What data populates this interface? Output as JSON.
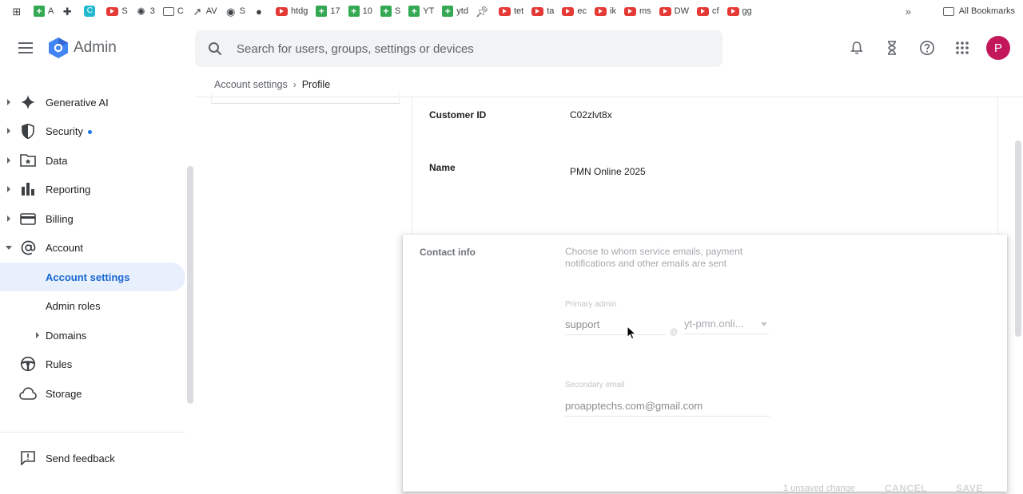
{
  "bookmarks": {
    "items": [
      {
        "label": "",
        "icon": "apps-grid-icon",
        "type": "plain"
      },
      {
        "label": "A",
        "icon": "sheets-icon",
        "type": "sheet"
      },
      {
        "label": "",
        "icon": "puzzle-icon",
        "type": "plain"
      },
      {
        "label": "",
        "icon": "canva-icon",
        "type": "canva"
      },
      {
        "label": "S",
        "icon": "youtube-icon",
        "type": "yt"
      },
      {
        "label": "3",
        "icon": "openai-icon",
        "type": "plain"
      },
      {
        "label": "C",
        "icon": "folder-icon",
        "type": "folder"
      },
      {
        "label": "AV",
        "icon": "trend-icon",
        "type": "plain"
      },
      {
        "label": "S",
        "icon": "globe-icon",
        "type": "plain"
      },
      {
        "label": "",
        "icon": "github-icon",
        "type": "plain"
      },
      {
        "label": "htdg",
        "icon": "youtube-icon",
        "type": "yt"
      },
      {
        "label": "17",
        "icon": "sheets-icon",
        "type": "sheet"
      },
      {
        "label": "10",
        "icon": "sheets-icon",
        "type": "sheet"
      },
      {
        "label": "S",
        "icon": "sheets-icon",
        "type": "sheet"
      },
      {
        "label": "YT",
        "icon": "sheets-icon",
        "type": "sheet"
      },
      {
        "label": "ytd",
        "icon": "sheets-icon",
        "type": "sheet"
      },
      {
        "label": "",
        "icon": "pin-icon",
        "type": "plain"
      },
      {
        "label": "tet",
        "icon": "youtube-icon",
        "type": "yt"
      },
      {
        "label": "ta",
        "icon": "youtube-icon",
        "type": "yt"
      },
      {
        "label": "ec",
        "icon": "youtube-icon",
        "type": "yt"
      },
      {
        "label": "ik",
        "icon": "youtube-icon",
        "type": "yt"
      },
      {
        "label": "ms",
        "icon": "youtube-icon",
        "type": "yt"
      },
      {
        "label": "DW",
        "icon": "youtube-icon",
        "type": "yt"
      },
      {
        "label": "cf",
        "icon": "youtube-icon",
        "type": "yt"
      },
      {
        "label": "gg",
        "icon": "youtube-icon",
        "type": "yt"
      }
    ],
    "more": "»",
    "all_bookmarks": "All Bookmarks"
  },
  "header": {
    "app_name": "Admin",
    "search_placeholder": "Search for users, groups, settings or devices",
    "avatar_letter": "P"
  },
  "breadcrumb": {
    "parent": "Account settings",
    "separator": "›",
    "current": "Profile"
  },
  "sidebar": {
    "items": [
      {
        "key": "generative-ai",
        "label": "Generative AI"
      },
      {
        "key": "security",
        "label": "Security"
      },
      {
        "key": "data",
        "label": "Data"
      },
      {
        "key": "reporting",
        "label": "Reporting"
      },
      {
        "key": "billing",
        "label": "Billing"
      },
      {
        "key": "account",
        "label": "Account"
      },
      {
        "key": "account-settings",
        "label": "Account settings"
      },
      {
        "key": "admin-roles",
        "label": "Admin roles"
      },
      {
        "key": "domains",
        "label": "Domains"
      },
      {
        "key": "rules",
        "label": "Rules"
      },
      {
        "key": "storage",
        "label": "Storage"
      }
    ],
    "feedback": "Send feedback"
  },
  "profile": {
    "customer_id_label": "Customer ID",
    "customer_id_value": "C02zlvt8x",
    "name_label": "Name",
    "name_value": "PMN Online 2025"
  },
  "contact": {
    "label": "Contact info",
    "description": "Choose to whom service emails, payment notifications and other emails are sent",
    "primary_admin_label": "Primary admin",
    "primary_admin_value": "support",
    "at_sign": "@",
    "domain_value": "yt-pmn.onli...",
    "secondary_email_label": "Secondary email",
    "secondary_email_value": "proapptechs.com@gmail.com",
    "unsaved": "1 unsaved change",
    "cancel": "CANCEL",
    "save": "SAVE"
  },
  "colors": {
    "accent": "#1a73e8",
    "active_bg": "#e8f0fe",
    "avatar": "#c2185b"
  }
}
